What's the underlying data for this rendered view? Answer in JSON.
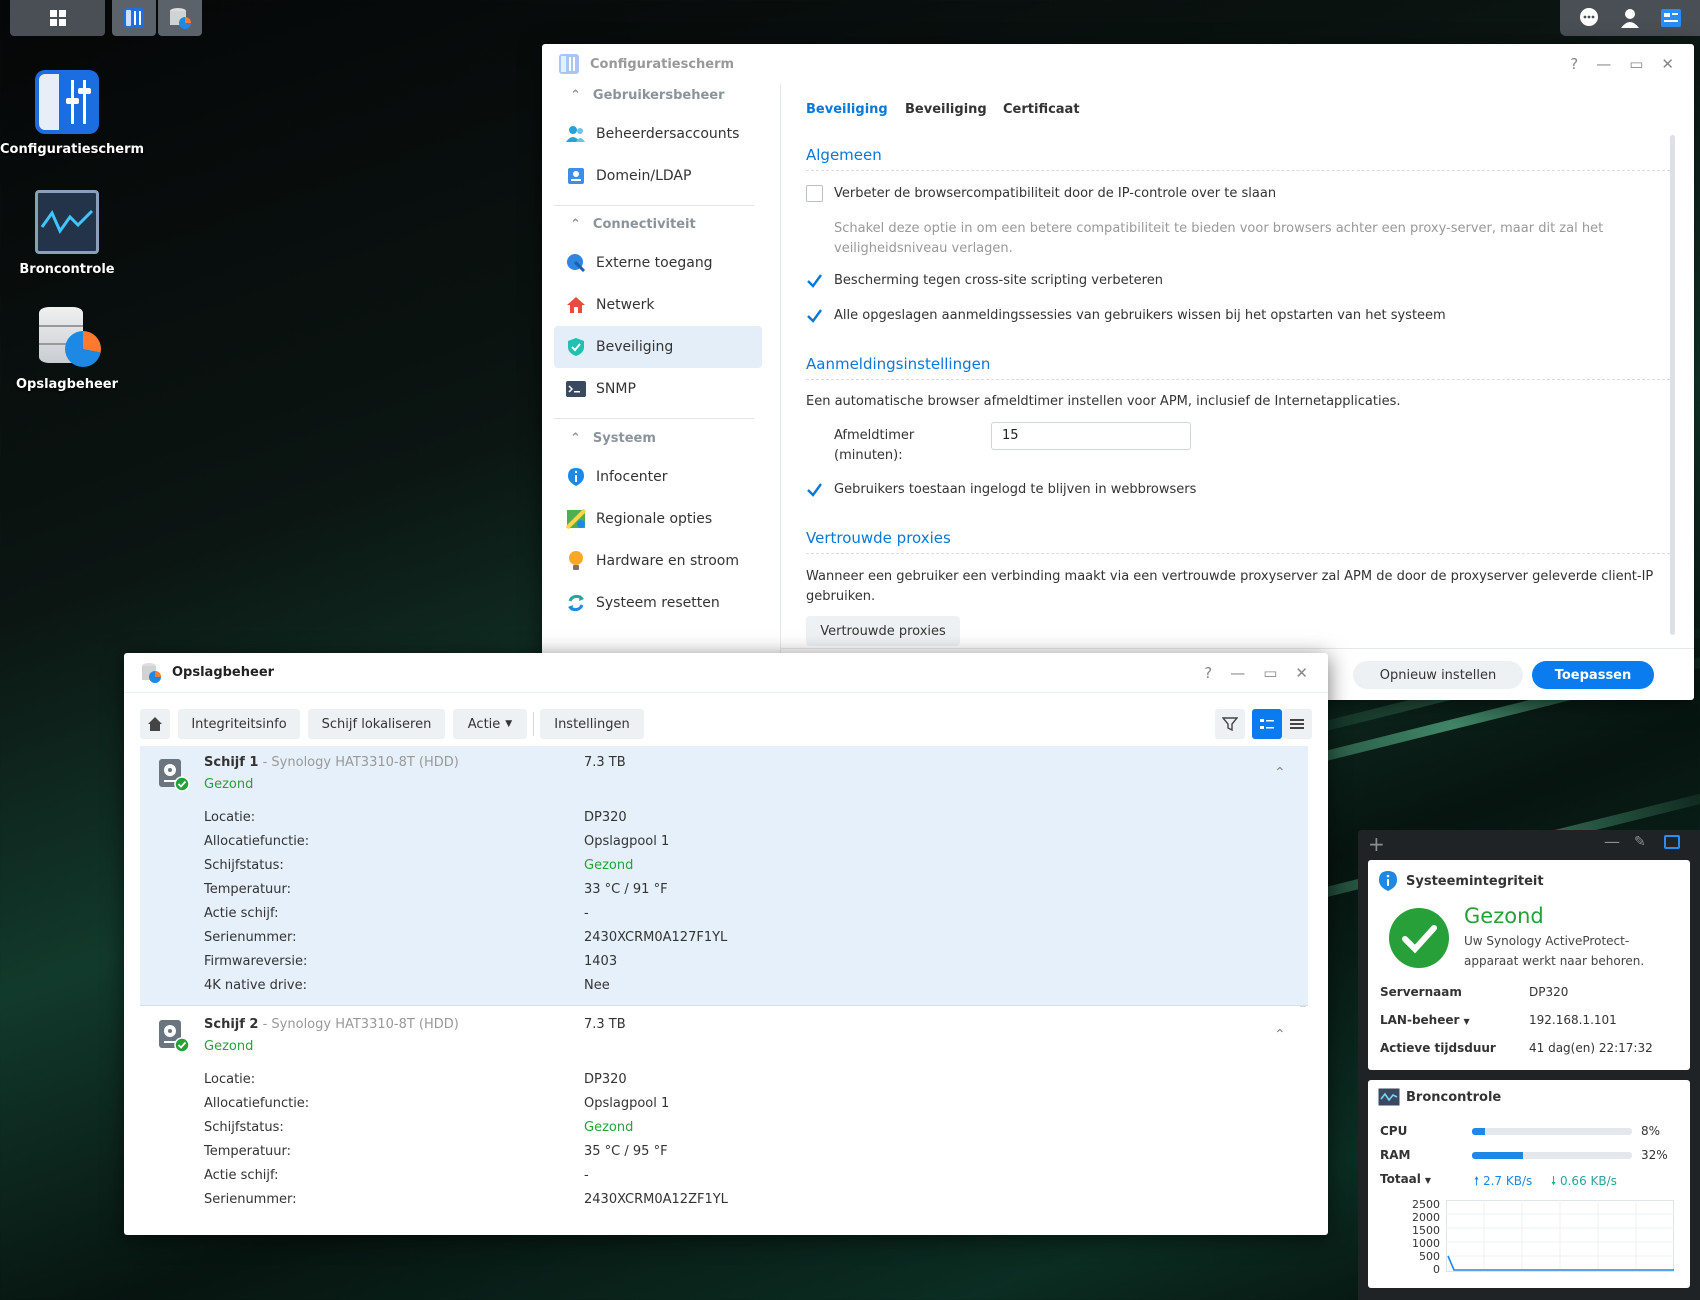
{
  "desktop": {
    "icons": [
      {
        "label": "Configuratiescherm"
      },
      {
        "label": "Broncontrole"
      },
      {
        "label": "Opslagbeheer"
      }
    ]
  },
  "control_panel": {
    "title": "Configuratiescherm",
    "sidebar": {
      "section1": "Gebruikersbeheer",
      "section2": "Connectiviteit",
      "section3": "Systeem",
      "items": [
        "Beheerdersaccounts",
        "Domein/LDAP",
        "Externe toegang",
        "Netwerk",
        "Beveiliging",
        "SNMP",
        "Infocenter",
        "Regionale opties",
        "Hardware en stroom",
        "Systeem resetten"
      ]
    },
    "tabs": [
      "Beveiliging",
      "Beveiliging",
      "Certificaat"
    ],
    "general": {
      "heading": "Algemeen",
      "opt1": "Verbeter de browsercompatibiliteit door de IP-controle over te slaan",
      "opt1_hint": "Schakel deze optie in om een betere compatibiliteit te bieden voor browsers achter een proxy-server, maar dit zal het veiligheidsniveau verlagen.",
      "opt2": "Bescherming tegen cross-site scripting verbeteren",
      "opt3": "Alle opgeslagen aanmeldingssessies van gebruikers wissen bij het opstarten van het systeem"
    },
    "login": {
      "heading": "Aanmeldingsinstellingen",
      "desc": "Een automatische browser afmeldtimer instellen voor APM, inclusief de Internetapplicaties.",
      "timer_label": "Afmeldtimer (minuten):",
      "timer_value": "15",
      "opt_stay": "Gebruikers toestaan ingelogd te blijven in webbrowsers"
    },
    "proxies": {
      "heading": "Vertrouwde proxies",
      "desc": "Wanneer een gebruiker een verbinding maakt via een vertrouwde proxyserver zal APM de door de proxyserver geleverde client-IP gebruiken.",
      "button": "Vertrouwde proxies"
    },
    "reset_button": "Opnieuw instellen",
    "apply_button": "Toepassen",
    "colors": {
      "accent": "#0978d8",
      "apply": "#0a7cf0"
    }
  },
  "storage": {
    "title": "Opslagbeheer",
    "toolbar": {
      "integrity": "Integriteitsinfo",
      "locate": "Schijf lokaliseren",
      "action": "Actie",
      "settings": "Instellingen"
    },
    "disk1": {
      "name": "Schijf 1",
      "model": " - Synology HAT3310-8T (HDD)",
      "size": "7.3 TB",
      "status": "Gezond",
      "rows": [
        {
          "label": "Locatie:",
          "value": "DP320"
        },
        {
          "label": "Allocatiefunctie:",
          "value": "Opslagpool 1"
        },
        {
          "label": "Schijfstatus:",
          "value": "Gezond"
        },
        {
          "label": "Temperatuur:",
          "value": "33 °C / 91 °F"
        },
        {
          "label": "Actie schijf:",
          "value": "-"
        },
        {
          "label": "Serienummer:",
          "value": "2430XCRM0A127F1YL"
        },
        {
          "label": "Firmwareversie:",
          "value": "1403"
        },
        {
          "label": "4K native drive:",
          "value": "Nee"
        }
      ]
    },
    "disk2": {
      "name": "Schijf 2",
      "model": " - Synology HAT3310-8T (HDD)",
      "size": "7.3 TB",
      "status": "Gezond",
      "rows": [
        {
          "label": "Locatie:",
          "value": "DP320"
        },
        {
          "label": "Allocatiefunctie:",
          "value": "Opslagpool 1"
        },
        {
          "label": "Schijfstatus:",
          "value": "Gezond"
        },
        {
          "label": "Temperatuur:",
          "value": "35 °C / 95 °F"
        },
        {
          "label": "Actie schijf:",
          "value": "-"
        },
        {
          "label": "Serienummer:",
          "value": "2430XCRM0A12ZF1YL"
        }
      ]
    },
    "colors": {
      "healthy": "#27a03a",
      "selected_row": "#e6f0fa"
    }
  },
  "widgets": {
    "health": {
      "title": "Systeemintegriteit",
      "status": "Gezond",
      "desc": "Uw Synology ActiveProtect-apparaat werkt naar behoren.",
      "server_label": "Servernaam",
      "server_value": "DP320",
      "lan_label": "LAN-beheer",
      "lan_value": "192.168.1.101",
      "uptime_label": "Actieve tijdsduur",
      "uptime_value": "41 dag(en) 22:17:32"
    },
    "monitor": {
      "title": "Broncontrole",
      "cpu_label": "CPU",
      "cpu_value": "8%",
      "cpu_fraction": 0.08,
      "ram_label": "RAM",
      "ram_value": "32%",
      "ram_fraction": 0.32,
      "total_label": "Totaal",
      "up": "2.7 KB/s",
      "down": "0.66 KB/s",
      "y_ticks": [
        "2500",
        "2000",
        "1500",
        "1000",
        "500",
        "0"
      ]
    }
  }
}
